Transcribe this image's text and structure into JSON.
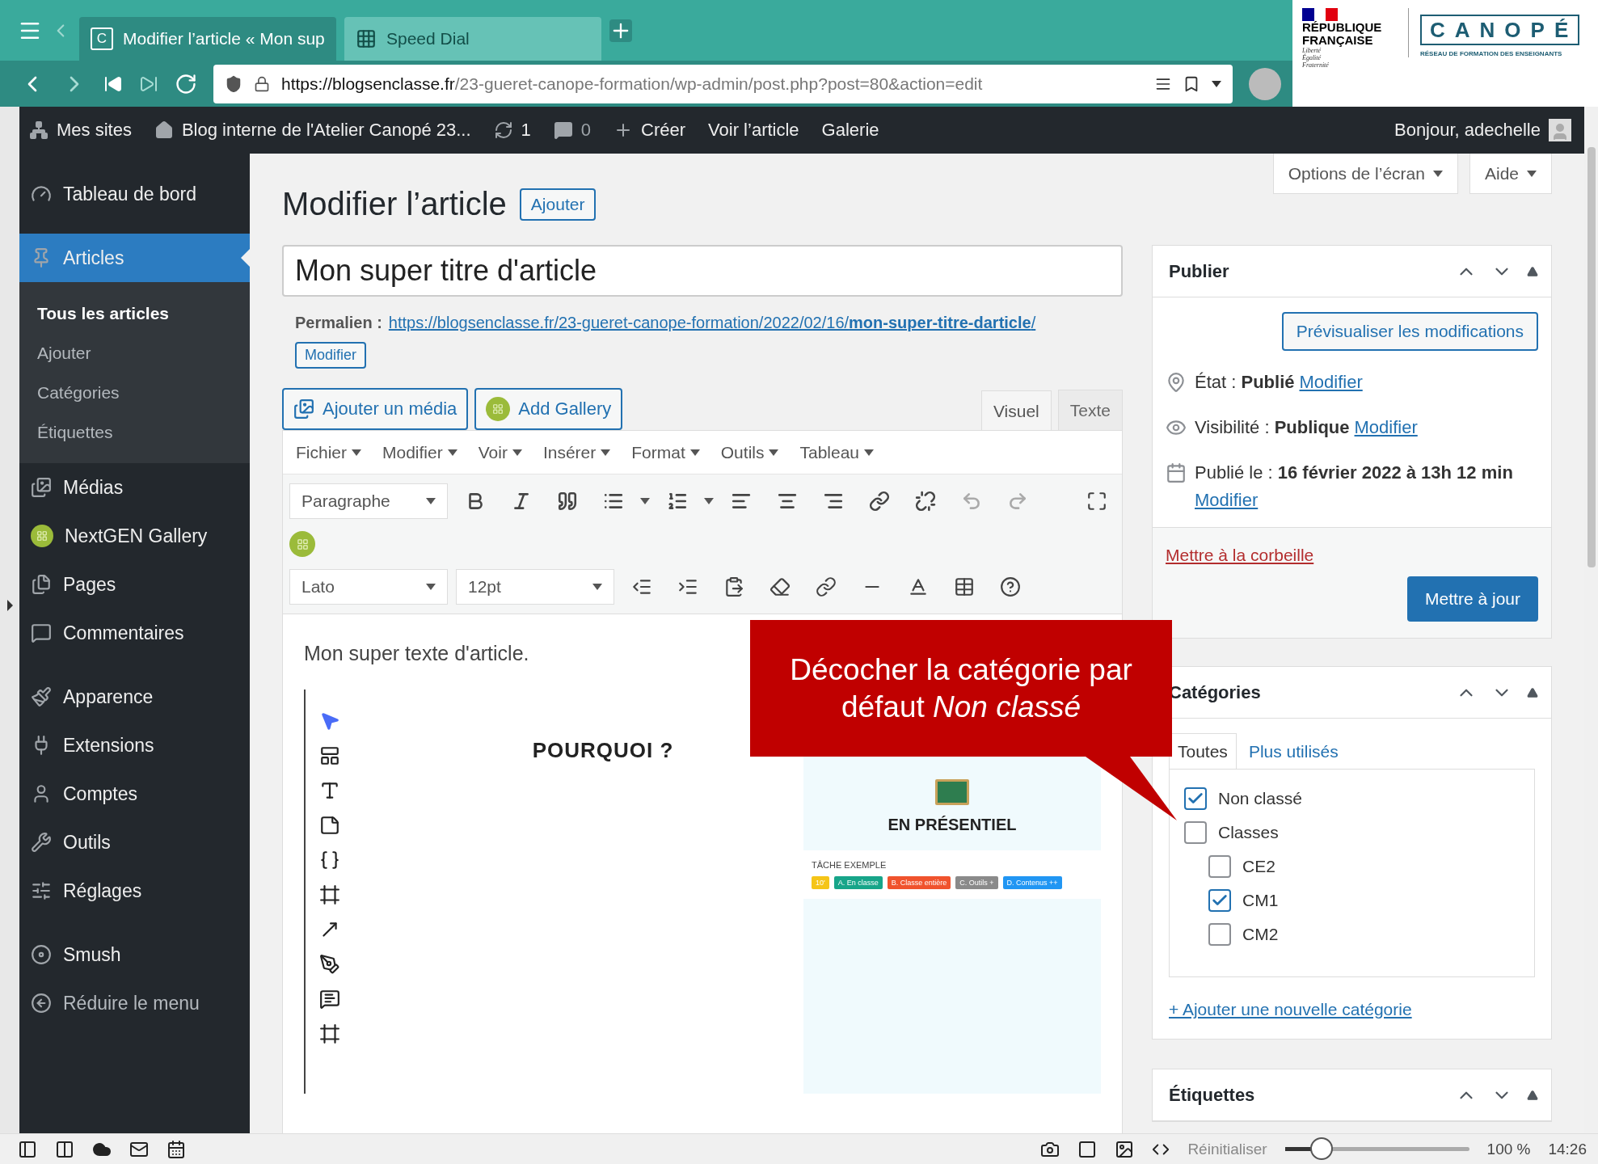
{
  "browser": {
    "tabs": [
      {
        "title": "Modifier l’article « Mon sup",
        "badge": "C",
        "selected": true
      },
      {
        "title": "Speed Dial",
        "selected": false
      }
    ],
    "url_host": "https://blogsenclasse.fr",
    "url_path": "/23-gueret-canope-formation/wp-admin/post.php?post=80&action=edit"
  },
  "logos": {
    "marianne_lines": [
      "RÉPUBLIQUE",
      "FRANÇAISE"
    ],
    "motto": [
      "Liberté",
      "Égalité",
      "Fraternité"
    ],
    "canope_letters": "CANOPÉ",
    "canope_tagline": "RÉSEAU DE FORMATION DES ENSEIGNANTS"
  },
  "admin_bar": {
    "items": [
      {
        "kind": "sites",
        "label": "Mes sites"
      },
      {
        "kind": "home",
        "label": "Blog interne de l'Atelier Canopé 23..."
      },
      {
        "kind": "updates",
        "label": "1"
      },
      {
        "kind": "comments",
        "label": "0"
      },
      {
        "kind": "new",
        "label": "Créer"
      },
      {
        "kind": "text",
        "label": "Voir l’article"
      },
      {
        "kind": "text",
        "label": "Galerie"
      }
    ],
    "greeting": "Bonjour, adechelle"
  },
  "sidebar": {
    "groups": [
      [
        {
          "kind": "dashboard",
          "label": "Tableau de bord",
          "selected": false
        }
      ],
      [
        {
          "kind": "posts",
          "label": "Articles",
          "selected": true,
          "submenu": [
            {
              "label": "Tous les articles",
              "selected": true
            },
            {
              "label": "Ajouter",
              "selected": false
            },
            {
              "label": "Catégories",
              "selected": false
            },
            {
              "label": "Étiquettes",
              "selected": false
            }
          ]
        },
        {
          "kind": "media",
          "label": "Médias",
          "selected": false
        },
        {
          "kind": "gallery",
          "label": "NextGEN Gallery",
          "selected": false
        },
        {
          "kind": "pages",
          "label": "Pages",
          "selected": false
        },
        {
          "kind": "comments",
          "label": "Commentaires",
          "selected": false
        }
      ],
      [
        {
          "kind": "appearance",
          "label": "Apparence",
          "selected": false
        },
        {
          "kind": "plugins",
          "label": "Extensions",
          "selected": false
        },
        {
          "kind": "users",
          "label": "Comptes",
          "selected": false
        },
        {
          "kind": "tools",
          "label": "Outils",
          "selected": false
        },
        {
          "kind": "settings",
          "label": "Réglages",
          "selected": false
        }
      ],
      [
        {
          "kind": "smush",
          "label": "Smush",
          "selected": false
        },
        {
          "kind": "collapse",
          "label": "Réduire le menu",
          "selected": false
        }
      ]
    ]
  },
  "screen_tabs": [
    "Options de l’écran",
    "Aide"
  ],
  "heading": {
    "title": "Modifier l’article",
    "action": "Ajouter"
  },
  "post_title": "Mon super titre d'article",
  "permalink": {
    "label": "Permalien :",
    "url": "https://blogsenclasse.fr/23-gueret-canope-formation/2022/02/16/**mon-super-titre-darticle**/",
    "button": "Modifier"
  },
  "media_buttons": [
    {
      "kind": "media",
      "label": "Ajouter un média"
    },
    {
      "kind": "gallery",
      "label": "Add Gallery"
    }
  ],
  "editor_tabs": [
    {
      "label": "Visuel",
      "selected": true
    },
    {
      "label": "Texte",
      "selected": false
    }
  ],
  "editor_menu": [
    "Fichier",
    "Modifier",
    "Voir",
    "Insérer",
    "Format",
    "Outils",
    "Tableau"
  ],
  "format_select": "Paragraphe",
  "font_select": "Lato",
  "size_select": "12pt",
  "content": {
    "text": "Mon super texte d'article.",
    "board": {
      "heading": "POURQUOI ?",
      "panel_title": "EN PRÉSENTIEL",
      "task_label": "TÂCHE EXEMPLE",
      "tags": [
        {
          "label": "10'",
          "color": "#f5c518"
        },
        {
          "label": "A. En classe",
          "color": "#17a589"
        },
        {
          "label": "B. Classe entière",
          "color": "#f0532d"
        },
        {
          "label": "C. Outils +",
          "color": "#8a8a8a"
        },
        {
          "label": "D. Contenus ++",
          "color": "#2196f3"
        }
      ]
    }
  },
  "publish": {
    "title": "Publier",
    "preview": "Prévisualiser les modifications",
    "rows": [
      {
        "kind": "status",
        "text": "État : **Publié**",
        "link": "Modifier"
      },
      {
        "kind": "visibility",
        "text": "Visibilité : **Publique**",
        "link": "Modifier"
      },
      {
        "kind": "date",
        "text": "Publié le : **16 février 2022 à 13h 12 min**",
        "link": "Modifier"
      }
    ],
    "trash": "Mettre à la corbeille",
    "update": "Mettre à jour"
  },
  "categories": {
    "title": "Catégories",
    "tabs": [
      {
        "label": "Toutes",
        "selected": true
      },
      {
        "label": "Plus utilisés",
        "selected": false
      }
    ],
    "items": [
      {
        "label": "Non classé",
        "checked": true
      },
      {
        "label": "Classes",
        "checked": false,
        "children": [
          {
            "label": "CE2",
            "checked": false
          },
          {
            "label": "CM1",
            "checked": true
          },
          {
            "label": "CM2",
            "checked": false
          }
        ]
      }
    ],
    "add_link": "+ Ajouter une nouvelle catégorie"
  },
  "tags_box": {
    "title": "Étiquettes"
  },
  "callout": {
    "text": "Décocher la catégorie par défaut *Non classé*"
  },
  "status_bar": {
    "reset": "Réinitialiser",
    "zoom": {
      "level": 0.2
    },
    "zoom_text": "100 %",
    "time": "14:26"
  }
}
